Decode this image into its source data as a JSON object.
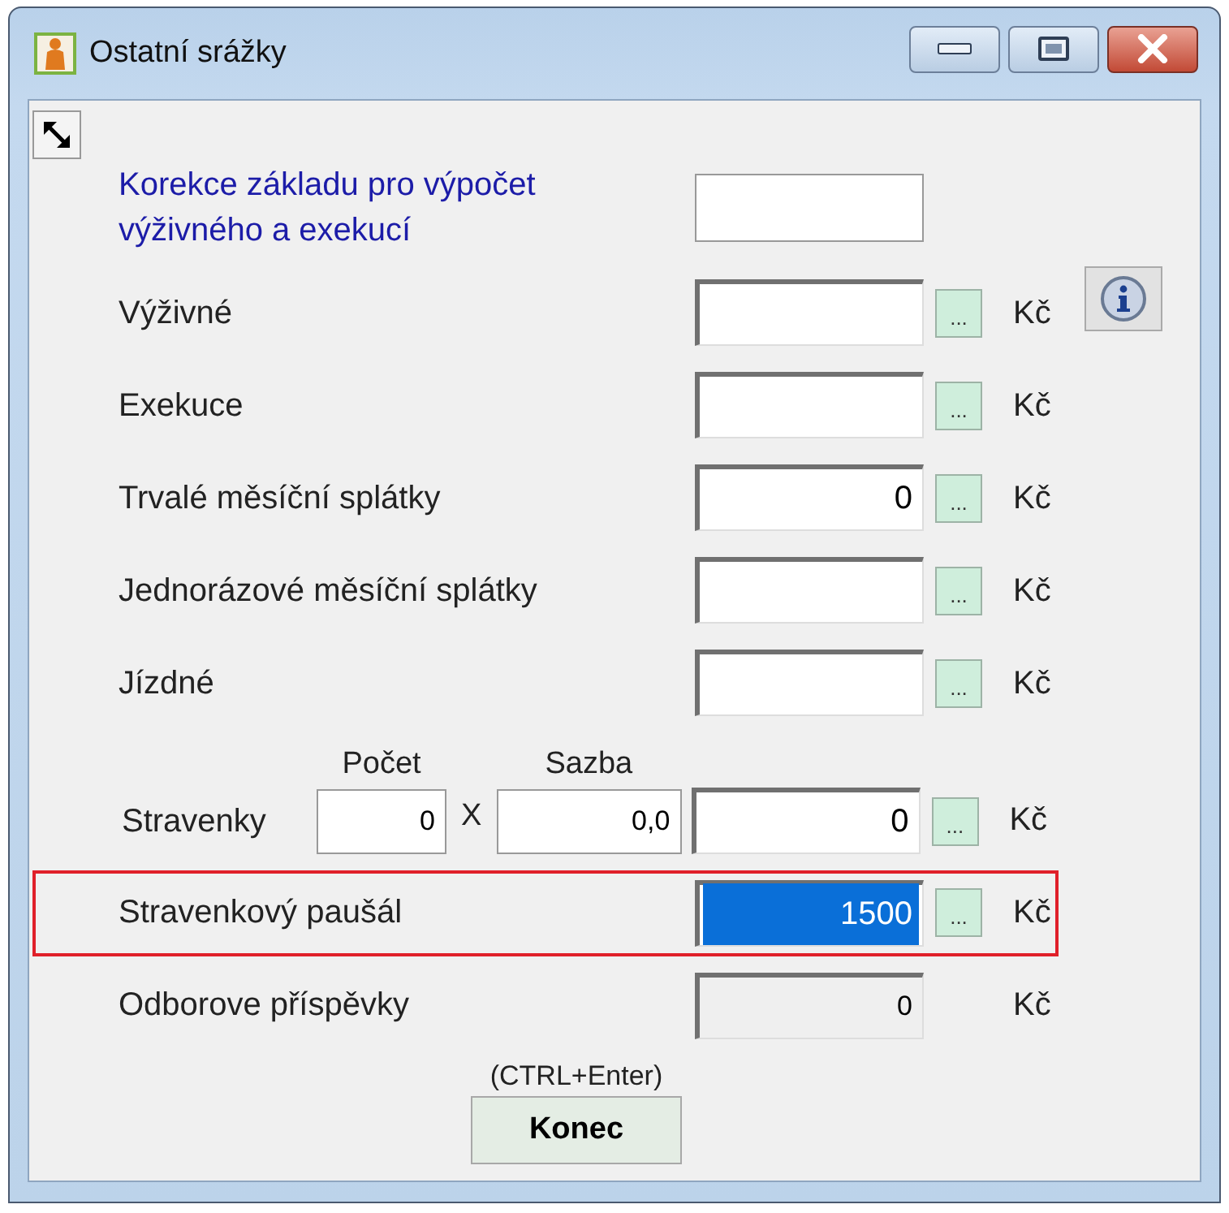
{
  "window": {
    "title": "Ostatní srážky"
  },
  "rows": [
    {
      "kind": "base",
      "label": "Korekce základu pro výpočet výživného a exekucí",
      "value": "",
      "highlighted": false,
      "selected": false
    },
    {
      "kind": "amount",
      "label": "Výživné",
      "value": "",
      "picker": "...",
      "currency": "Kč",
      "highlighted": false,
      "selected": false
    },
    {
      "kind": "amount",
      "label": "Exekuce",
      "value": "",
      "picker": "...",
      "currency": "Kč",
      "highlighted": false,
      "selected": false
    },
    {
      "kind": "amount",
      "label": "Trvalé měsíční splátky",
      "value": "0",
      "picker": "...",
      "currency": "Kč",
      "highlighted": false,
      "selected": false
    },
    {
      "kind": "amount",
      "label": "Jednorázové měsíční splátky",
      "value": "",
      "picker": "...",
      "currency": "Kč",
      "highlighted": false,
      "selected": false
    },
    {
      "kind": "amount",
      "label": "Jízdné",
      "value": "",
      "picker": "...",
      "currency": "Kč",
      "highlighted": false,
      "selected": false
    },
    {
      "kind": "meals",
      "label": "Stravenky",
      "count_label": "Počet",
      "count": "0",
      "times": "X",
      "rate_label": "Sazba",
      "rate": "0,0",
      "value": "0",
      "picker": "...",
      "currency": "Kč",
      "highlighted": false,
      "selected": false
    },
    {
      "kind": "amount",
      "label": "Stravenkový paušál",
      "value": "1500",
      "picker": "...",
      "currency": "Kč",
      "highlighted": true,
      "selected": true
    },
    {
      "kind": "readonly",
      "label": "Odborove příspěvky",
      "value": "0",
      "currency": "Kč",
      "highlighted": false,
      "selected": false
    }
  ],
  "hint": "(CTRL+Enter)",
  "close_button": "Konec"
}
